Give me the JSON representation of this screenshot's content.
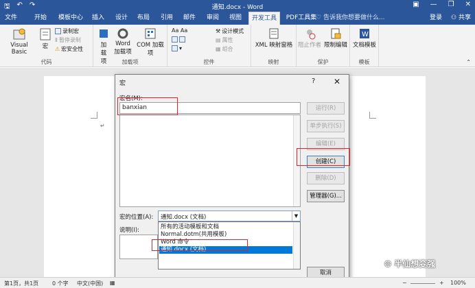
{
  "titlebar": {
    "title": "通知.docx - Word",
    "save_icon": "save-icon",
    "undo_icon": "undo-icon",
    "redo_icon": "redo-icon"
  },
  "tabs": [
    "文件",
    "开始",
    "模板中心",
    "插入",
    "设计",
    "布局",
    "引用",
    "邮件",
    "审阅",
    "视图",
    "开发工具",
    "PDF工具集"
  ],
  "active_tab": "开发工具",
  "tell_me": "告诉我你想要做什么...",
  "login": "登录",
  "share": "共享",
  "ribbon": {
    "code": {
      "visual_basic": "Visual Basic",
      "macro": "宏",
      "record_macro": "录制宏",
      "pause_recording": "暂停录制",
      "macro_security": "宏安全性",
      "label": "代码"
    },
    "addins": {
      "add": "加载项",
      "word_addins": "Word 加载项",
      "com_addins": "COM 加载项",
      "label": "加载项"
    },
    "controls": {
      "design_mode": "设计模式",
      "properties": "属性",
      "group": "组合",
      "label": "控件"
    },
    "mapping": {
      "xml_pane": "XML 映射窗格",
      "label": "映射"
    },
    "protect": {
      "block_authors": "阻止作者",
      "restrict_editing": "限制编辑",
      "label": "保护"
    },
    "templates": {
      "document_template": "文档模板",
      "label": "模板"
    }
  },
  "dialog": {
    "title": "宏",
    "help": "?",
    "name_label": "宏名(M):",
    "name_value": "banxian",
    "buttons": {
      "run": "运行(R)",
      "step": "单步执行(S)",
      "edit": "编辑(E)",
      "create": "创建(C)",
      "delete": "删除(D)",
      "organizer": "管理器(G)...",
      "cancel": "取消"
    },
    "location_label": "宏的位置(A):",
    "location_value": "通知.docx (文档)",
    "location_options": [
      "所有的活动模板和文档",
      "Normal.dotm(共用模板)",
      "Word 命令",
      "通知.docx (文档)"
    ],
    "selected_option": 3,
    "desc_label": "说明(I):"
  },
  "status": {
    "page": "第1页，共1页",
    "words": "0 个字",
    "language": "中文(中国)",
    "zoom": "100%"
  },
  "watermark": "半仙想变强"
}
